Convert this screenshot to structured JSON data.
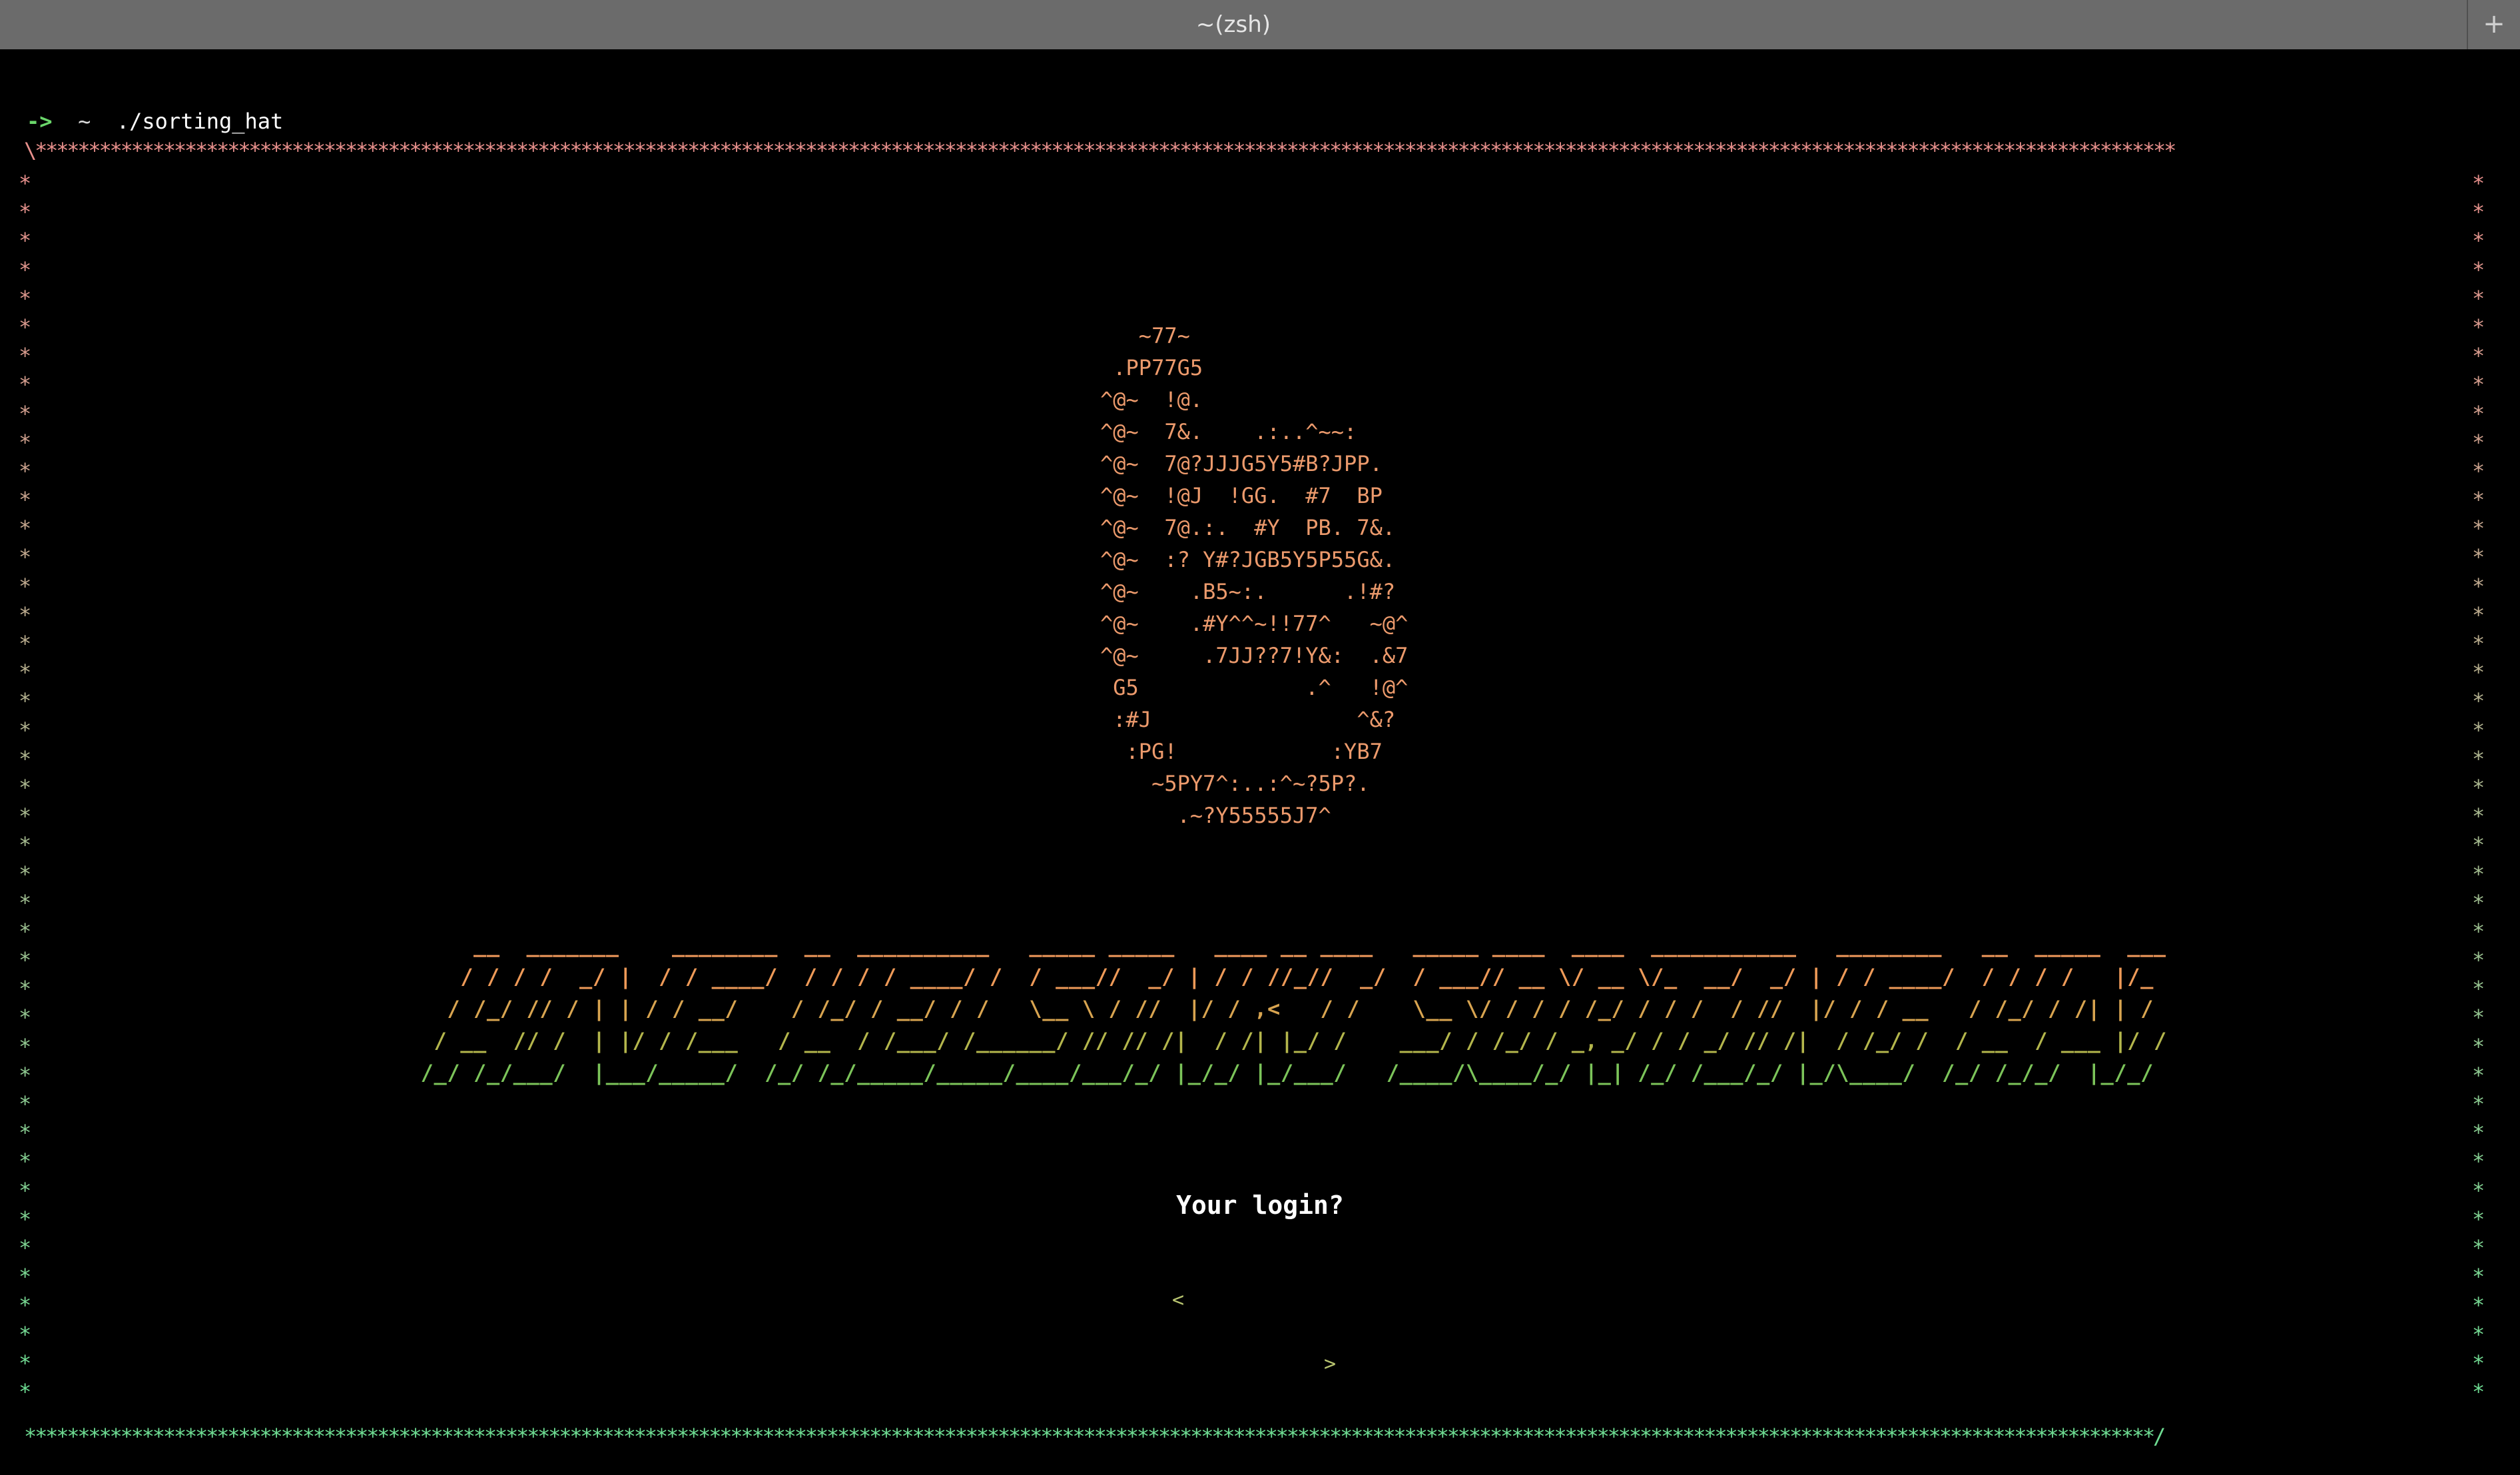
{
  "window": {
    "title": "~(zsh)",
    "new_tab_label": "+"
  },
  "prompt": {
    "arrow": "->",
    "cwd": "~",
    "command": "./sorting_hat"
  },
  "frame": {
    "top_left_corner": "\\",
    "bottom_right_corner": "/",
    "star_char": "*",
    "top_color": "#e8908c",
    "bottom_color": "#6edc92"
  },
  "hat_art": "   ~77~\n .PP77G5\n^@~  !@.\n^@~  7&.    .:..^~~:\n^@~  7@?JJJG5Y5#B?JPP.\n^@~  !@J  !GG.  #7  BP\n^@~  7@.:.  #Y  PB. 7&.\n^@~  :? Y#?JGB5Y5P55G&.\n^@~    .B5~:.      .!#?\n^@~    .#Y^^~!!77^   ~@^\n^@~     .7JJ??7!Y&:  .&7\n G5             .^   !@^\n :#J                ^&?\n  :PG!            :YB7\n    ~5PY7^:..:^~?5P?.\n      .~?Y55555J7^",
  "banner": {
    "lines": [
      "       __  _______    ________  __  __________   _____ _____   ____ __ ____   _____ ____  ____  ___________   ________   __  _____  ______",
      "      / / / /  _/ |  / / ____/  / / / / ____/ /  / ___//  _/ | / / //_//  _/  / ___// __ \\/ __ \\/_  __/  _/ | / / ____/  / / / /   |/_  __/",
      "     / /_/ // / | | / / __/    / /_/ / __/ / /   \\__ \\ / //  |/ / ,<   / /    \\__ \\/ / / / /_/ / / /  / //  |/ / / __   / /_/ / /| | / /",
      "    / __  // /  | |/ / /___   / __  / /___/ /______/ // // /|  / /| |_/ /    ___/ / /_/ / _, _/ / / _/ // /|  / /_/ /  / __  / ___ |/ /",
      "   /_/ /_/___/  |___/_____/  /_/ /_/_____/_____/____/___/_/ |_/_/ |_/___/   /____/\\____/_/ |_| /_/ /___/_/ |_/\\____/  /_/ /_/_/  |_/_/"
    ],
    "line_colors": [
      "#f29a5c",
      "#ee9a58",
      "#d8a450",
      "#b4b64c",
      "#7cc45a"
    ]
  },
  "login": {
    "label": "Your login?",
    "left_bracket": "<",
    "right_bracket": ">",
    "value": ""
  }
}
